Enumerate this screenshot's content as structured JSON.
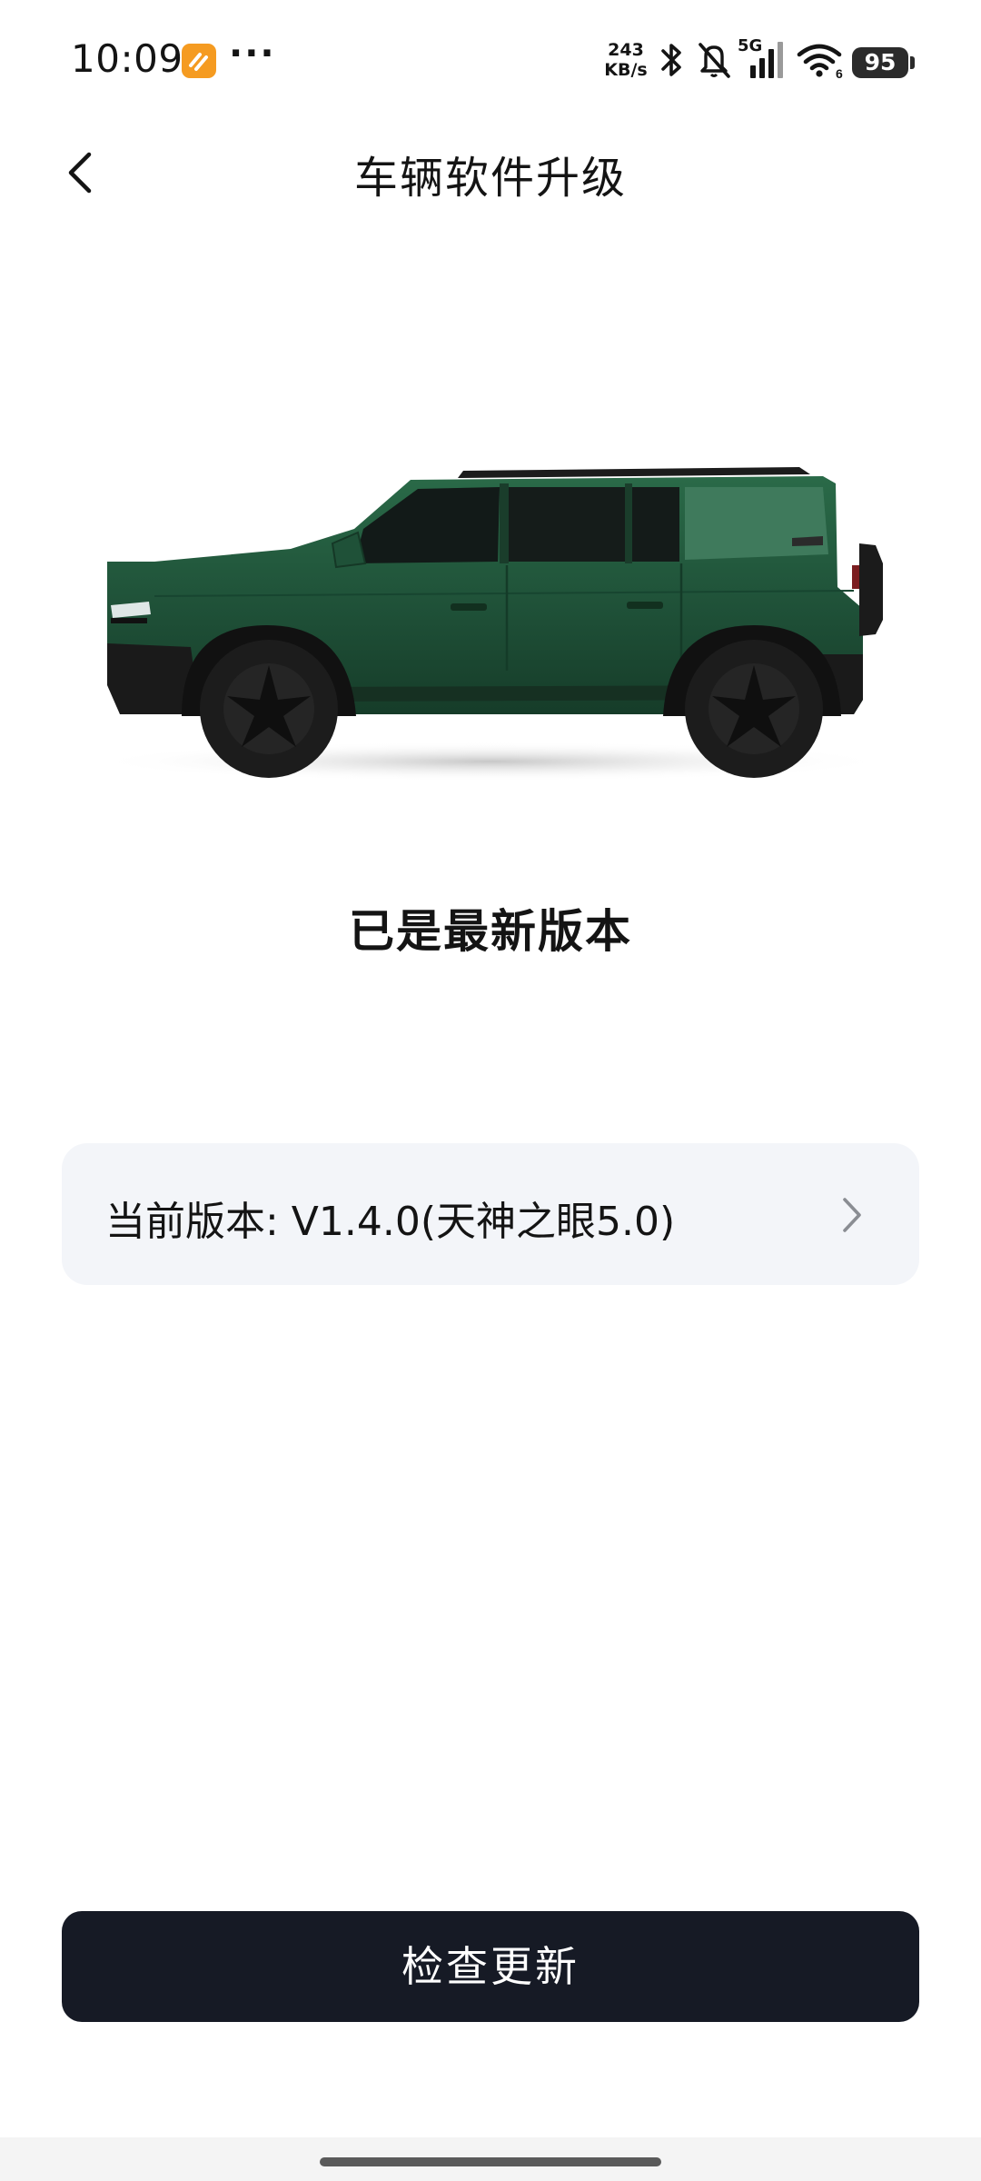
{
  "status_bar": {
    "time": "10:09",
    "more": "···",
    "net_speed_value": "243",
    "net_speed_unit": "KB/s",
    "signal_label": "5G",
    "battery": "95",
    "icons": [
      "app-notification-icon",
      "bluetooth-icon",
      "mute-icon",
      "signal-icon",
      "wifi-icon",
      "battery-icon"
    ]
  },
  "nav": {
    "back_icon": "chevron-left-icon",
    "title": "车辆软件升级"
  },
  "car": {
    "image": "green-suv-side-view",
    "body_color": "#1f5138"
  },
  "main": {
    "status_text": "已是最新版本",
    "version_label": "当前版本: V1.4.0(天神之眼5.0)",
    "version_chevron": "chevron-right-icon"
  },
  "actions": {
    "check_update_label": "检查更新"
  },
  "colors": {
    "card_bg": "#f3f5f9",
    "button_bg": "#161a25",
    "app_icon": "#f59b21"
  }
}
